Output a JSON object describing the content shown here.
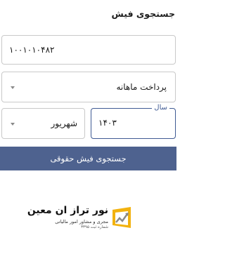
{
  "page": {
    "title": "جستجوی فیش"
  },
  "form": {
    "fish_number": "۱۰۰۱۰۱۰۴۸۲",
    "type_value": "پرداخت ماهانه",
    "year_label": "سال",
    "year_value": "۱۴۰۳",
    "month_value": "شهریور",
    "search_button_label": "جستجوی فیش حقوقی"
  },
  "logo": {
    "name": "نور تراز ان معین",
    "subtitle": "مجری و مشاور امور مالیاتی",
    "registration": "شماره ثبت ۳۳۹۵"
  },
  "colors": {
    "accent": "#3f5a93",
    "button": "#4e628f",
    "logo_yellow": "#f2b20f",
    "logo_gray": "#8a8a8a"
  },
  "icons": [
    "dropdown-caret-icon",
    "logo-icon"
  ]
}
